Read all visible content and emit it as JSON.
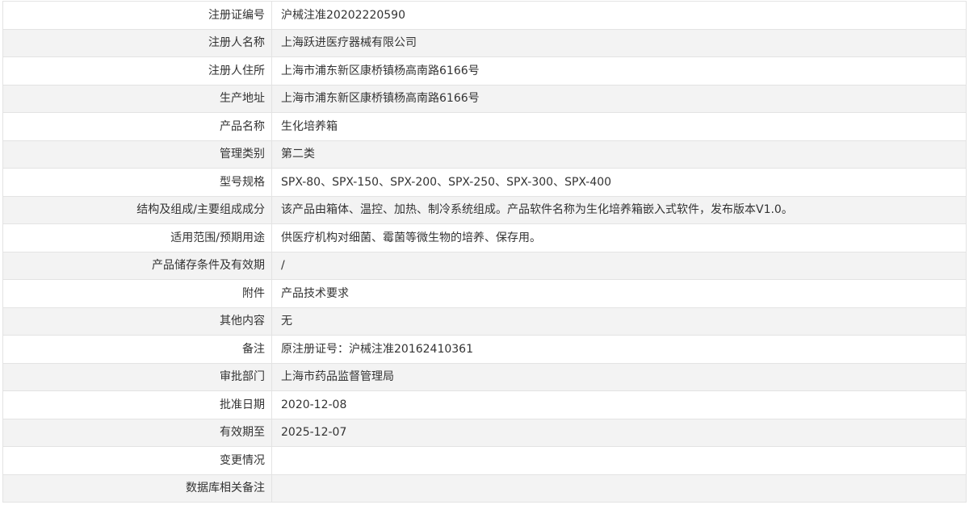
{
  "rows": [
    {
      "label": "注册证编号",
      "value": "沪械注准20202220590"
    },
    {
      "label": "注册人名称",
      "value": "上海跃进医疗器械有限公司"
    },
    {
      "label": "注册人住所",
      "value": "上海市浦东新区康桥镇杨高南路6166号"
    },
    {
      "label": "生产地址",
      "value": "上海市浦东新区康桥镇杨高南路6166号"
    },
    {
      "label": "产品名称",
      "value": "生化培养箱"
    },
    {
      "label": "管理类别",
      "value": "第二类"
    },
    {
      "label": "型号规格",
      "value": "SPX-80、SPX-150、SPX-200、SPX-250、SPX-300、SPX-400"
    },
    {
      "label": "结构及组成/主要组成成分",
      "value": "该产品由箱体、温控、加热、制冷系统组成。产品软件名称为生化培养箱嵌入式软件，发布版本V1.0。"
    },
    {
      "label": "适用范围/预期用途",
      "value": "供医疗机构对细菌、霉菌等微生物的培养、保存用。"
    },
    {
      "label": "产品储存条件及有效期",
      "value": "/"
    },
    {
      "label": "附件",
      "value": "产品技术要求"
    },
    {
      "label": "其他内容",
      "value": "无"
    },
    {
      "label": "备注",
      "value": "原注册证号：沪械注准20162410361"
    },
    {
      "label": "审批部门",
      "value": "上海市药品监督管理局"
    },
    {
      "label": "批准日期",
      "value": "2020-12-08"
    },
    {
      "label": "有效期至",
      "value": "2025-12-07"
    },
    {
      "label": "变更情况",
      "value": ""
    },
    {
      "label": "数据库相关备注",
      "value": ""
    }
  ]
}
